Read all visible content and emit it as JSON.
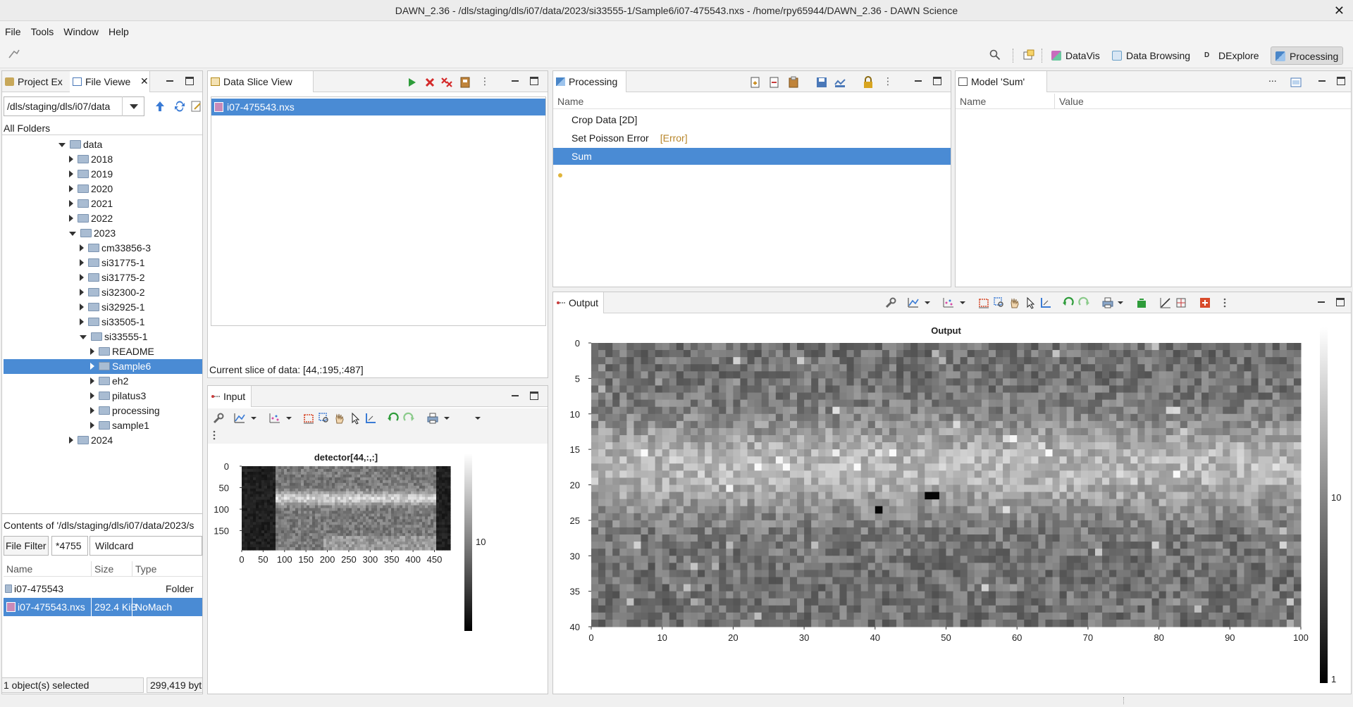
{
  "window": {
    "title": "DAWN_2.36 - /dls/staging/dls/i07/data/2023/si33555-1/Sample6/i07-475543.nxs - /home/rpy65944/DAWN_2.36 - DAWN Science",
    "close": "✕"
  },
  "menu": [
    "File",
    "Tools",
    "Window",
    "Help"
  ],
  "perspectives": [
    {
      "label": "DataVis",
      "color": "#c86bbd"
    },
    {
      "label": "Data Browsing",
      "color": "#6aa0c8"
    },
    {
      "label": "DExplore",
      "color": "#333333"
    },
    {
      "label": "Processing",
      "color": "#4a86c8"
    }
  ],
  "left_panel": {
    "tabs": [
      "Project Ex",
      "File Viewe"
    ],
    "path": "/dls/staging/dls/i07/data",
    "all_folders": "All Folders",
    "tree": [
      {
        "label": "data",
        "depth": 0,
        "state": "open"
      },
      {
        "label": "2018",
        "depth": 1,
        "state": "closed"
      },
      {
        "label": "2019",
        "depth": 1,
        "state": "closed"
      },
      {
        "label": "2020",
        "depth": 1,
        "state": "closed"
      },
      {
        "label": "2021",
        "depth": 1,
        "state": "closed"
      },
      {
        "label": "2022",
        "depth": 1,
        "state": "closed"
      },
      {
        "label": "2023",
        "depth": 1,
        "state": "open"
      },
      {
        "label": "cm33856-3",
        "depth": 2,
        "state": "closed"
      },
      {
        "label": "si31775-1",
        "depth": 2,
        "state": "closed"
      },
      {
        "label": "si31775-2",
        "depth": 2,
        "state": "closed"
      },
      {
        "label": "si32300-2",
        "depth": 2,
        "state": "closed"
      },
      {
        "label": "si32925-1",
        "depth": 2,
        "state": "closed"
      },
      {
        "label": "si33505-1",
        "depth": 2,
        "state": "closed"
      },
      {
        "label": "si33555-1",
        "depth": 2,
        "state": "open"
      },
      {
        "label": "README",
        "depth": 3,
        "state": "closed"
      },
      {
        "label": "Sample6",
        "depth": 3,
        "state": "closed",
        "selected": true
      },
      {
        "label": "eh2",
        "depth": 3,
        "state": "closed"
      },
      {
        "label": "pilatus3",
        "depth": 3,
        "state": "closed"
      },
      {
        "label": "processing",
        "depth": 3,
        "state": "closed"
      },
      {
        "label": "sample1",
        "depth": 3,
        "state": "closed"
      },
      {
        "label": "2024",
        "depth": 1,
        "state": "closed"
      }
    ],
    "contents_label": "Contents of '/dls/staging/dls/i07/data/2023/s",
    "file_filter_label": "File Filter",
    "file_filter_value": "*4755",
    "wildcard": "Wildcard",
    "columns": [
      "Name",
      "Size",
      "Type"
    ],
    "files": [
      {
        "name": "i07-475543",
        "size": "",
        "type": "Folder"
      },
      {
        "name": "i07-475543.nxs",
        "size": "292.4 KiB",
        "type": "NoMach",
        "selected": true
      }
    ],
    "status_left": "1 object(s) selected",
    "status_right": "299,419 byt"
  },
  "slice_panel": {
    "tab": "Data Slice View",
    "file": "i07-475543.nxs",
    "nav": [
      "⏮",
      "⏪",
      "◀",
      "▶",
      "⏩",
      "⏭"
    ],
    "current_slice": "Current slice of data: [44,:195,:487]"
  },
  "input_panel": {
    "tab": "Input"
  },
  "processing_panel": {
    "tab": "Processing",
    "column": "Name",
    "ops": [
      {
        "name": "Crop Data [2D]",
        "note": ""
      },
      {
        "name": "Set Poisson Error",
        "note": "[Error]"
      },
      {
        "name": "Sum",
        "note": "",
        "selected": true
      }
    ]
  },
  "model_panel": {
    "tab": "Model 'Sum'",
    "columns": [
      "Name",
      "Value"
    ],
    "more": "..."
  },
  "output_panel": {
    "tab": "Output"
  },
  "chart_data": [
    {
      "type": "heatmap",
      "title": "detector[44,:,:]",
      "x_ticks": [
        "0",
        "50",
        "100",
        "150",
        "200",
        "250",
        "300",
        "350",
        "400",
        "450"
      ],
      "y_ticks": [
        "0",
        "50",
        "100",
        "150"
      ],
      "xlim": [
        0,
        487
      ],
      "ylim": [
        0,
        195
      ],
      "colorbar_label": "10"
    },
    {
      "type": "heatmap",
      "title": "Output",
      "x_ticks": [
        "0",
        "10",
        "20",
        "30",
        "40",
        "50",
        "60",
        "70",
        "80",
        "90",
        "100"
      ],
      "y_ticks": [
        "0",
        "5",
        "10",
        "15",
        "20",
        "25",
        "30",
        "35",
        "40"
      ],
      "xlim": [
        0,
        100
      ],
      "ylim": [
        0,
        40
      ],
      "colorbar_ticks": [
        "10",
        "1"
      ],
      "dark_pixels": [
        {
          "x": 40,
          "y": 23
        },
        {
          "x": 47,
          "y": 21
        },
        {
          "x": 48,
          "y": 21
        }
      ]
    }
  ]
}
